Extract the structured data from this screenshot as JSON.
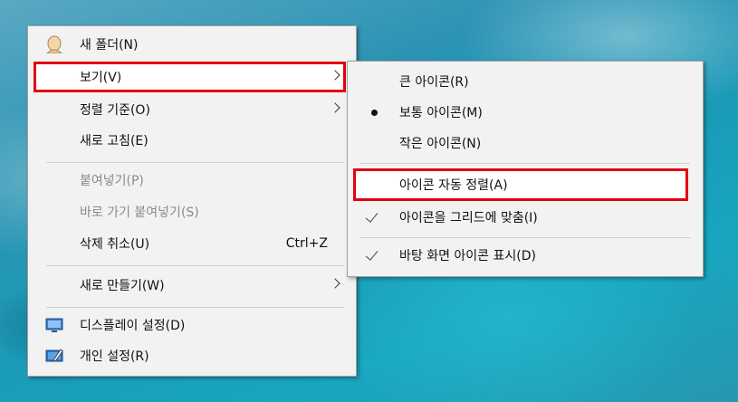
{
  "main_menu": {
    "items": [
      {
        "label": "새 폴더(N)",
        "icon": "user-avatar-icon"
      },
      {
        "label": "보기(V)",
        "submenu": true,
        "highlighted": true
      },
      {
        "label": "정렬 기준(O)",
        "submenu": true
      },
      {
        "label": "새로 고침(E)"
      },
      {
        "label": "붙여넣기(P)",
        "disabled": true
      },
      {
        "label": "바로 가기 붙여넣기(S)",
        "disabled": true
      },
      {
        "label": "삭제 취소(U)",
        "shortcut": "Ctrl+Z"
      },
      {
        "label": "새로 만들기(W)",
        "submenu": true
      },
      {
        "label": "디스플레이 설정(D)",
        "icon": "display-icon"
      },
      {
        "label": "개인 설정(R)",
        "icon": "personalize-icon"
      }
    ]
  },
  "view_submenu": {
    "items": [
      {
        "label": "큰 아이콘(R)"
      },
      {
        "label": "보통 아이콘(M)",
        "selected": true
      },
      {
        "label": "작은 아이콘(N)"
      },
      {
        "label": "아이콘 자동 정렬(A)",
        "highlighted": true
      },
      {
        "label": "아이콘을 그리드에 맞춤(I)",
        "checked": true
      },
      {
        "label": "바탕 화면 아이콘 표시(D)",
        "checked": true
      }
    ]
  },
  "colors": {
    "highlight_border": "#e3000f",
    "menu_background": "#f2f2f2",
    "disabled_text": "#8a8a8a"
  }
}
